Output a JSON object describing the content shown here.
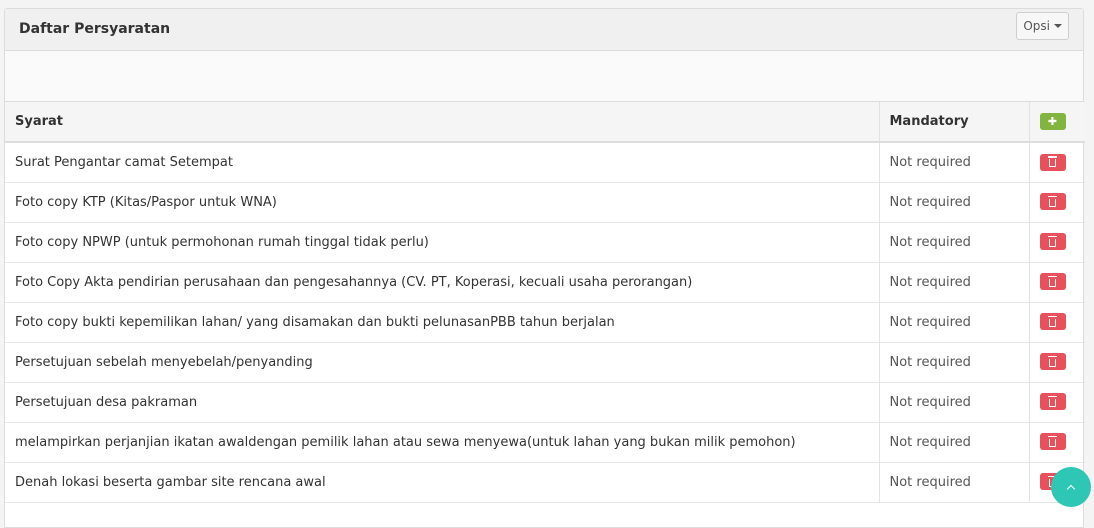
{
  "panel": {
    "title": "Daftar Persyaratan",
    "options_label": "Opsi"
  },
  "table": {
    "headers": {
      "syarat": "Syarat",
      "mandatory": "Mandatory",
      "add_icon": "plus-icon"
    },
    "rows": [
      {
        "syarat": "Surat Pengantar camat Setempat",
        "mandatory": "Not required"
      },
      {
        "syarat": "Foto copy KTP (Kitas/Paspor untuk WNA)",
        "mandatory": "Not required"
      },
      {
        "syarat": "Foto copy NPWP (untuk permohonan rumah tinggal tidak perlu)",
        "mandatory": "Not required"
      },
      {
        "syarat": "Foto Copy Akta pendirian perusahaan dan pengesahannya (CV. PT, Koperasi, kecuali usaha perorangan)",
        "mandatory": "Not required"
      },
      {
        "syarat": "Foto copy bukti kepemilikan lahan/ yang disamakan dan bukti pelunasanPBB tahun berjalan",
        "mandatory": "Not required"
      },
      {
        "syarat": "Persetujuan sebelah menyebelah/penyanding",
        "mandatory": "Not required"
      },
      {
        "syarat": "Persetujuan desa pakraman",
        "mandatory": "Not required"
      },
      {
        "syarat": "melampirkan perjanjian ikatan awaldengan pemilik lahan atau sewa menyewa(untuk lahan yang bukan milik pemohon)",
        "mandatory": "Not required"
      },
      {
        "syarat": "Denah lokasi beserta gambar site rencana awal",
        "mandatory": "Not required"
      }
    ],
    "delete_icon": "trash-icon"
  },
  "scroll_top_icon": "chevron-up-icon",
  "colors": {
    "add": "#82b440",
    "delete": "#e8505b",
    "scroll_top": "#2ec7b5"
  }
}
